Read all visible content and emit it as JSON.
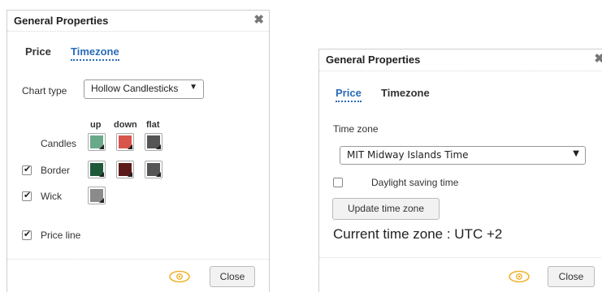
{
  "dialog1": {
    "title": "General Properties",
    "close_glyph": "✖",
    "tabs": [
      "Price",
      "Timezone"
    ],
    "active_tab": "Timezone",
    "chart_type_label": "Chart type",
    "chart_type_value": "Hollow Candlesticks",
    "dropdown_arrow": "▼",
    "column_headers": [
      "up",
      "down",
      "flat"
    ],
    "rows": [
      {
        "label": "Candles",
        "checked": null,
        "colors": [
          "#6aa88a",
          "#d9544a",
          "#555555"
        ]
      },
      {
        "label": "Border",
        "checked": true,
        "colors": [
          "#1e5a3a",
          "#5c1a1a",
          "#555555"
        ]
      },
      {
        "label": "Wick",
        "checked": true,
        "colors": [
          "#8a8a8a"
        ]
      }
    ],
    "price_line_label": "Price line",
    "price_line_checked": true,
    "close_button": "Close",
    "eye_icon": "eye-icon"
  },
  "dialog2": {
    "title": "General Properties",
    "close_glyph": "✖",
    "tabs": [
      "Price",
      "Timezone"
    ],
    "active_tab": "Price",
    "timezone_label": "Time zone",
    "timezone_value": "MIT Midway Islands Time",
    "dropdown_arrow": "▼",
    "dst_label": "Daylight saving time",
    "dst_checked": false,
    "update_button": "Update time zone",
    "current_tz": "Current time zone : UTC +2",
    "close_button": "Close",
    "eye_icon": "eye-icon"
  },
  "colors": {
    "accent": "#2a6bb8",
    "eye": "#f0b330"
  }
}
